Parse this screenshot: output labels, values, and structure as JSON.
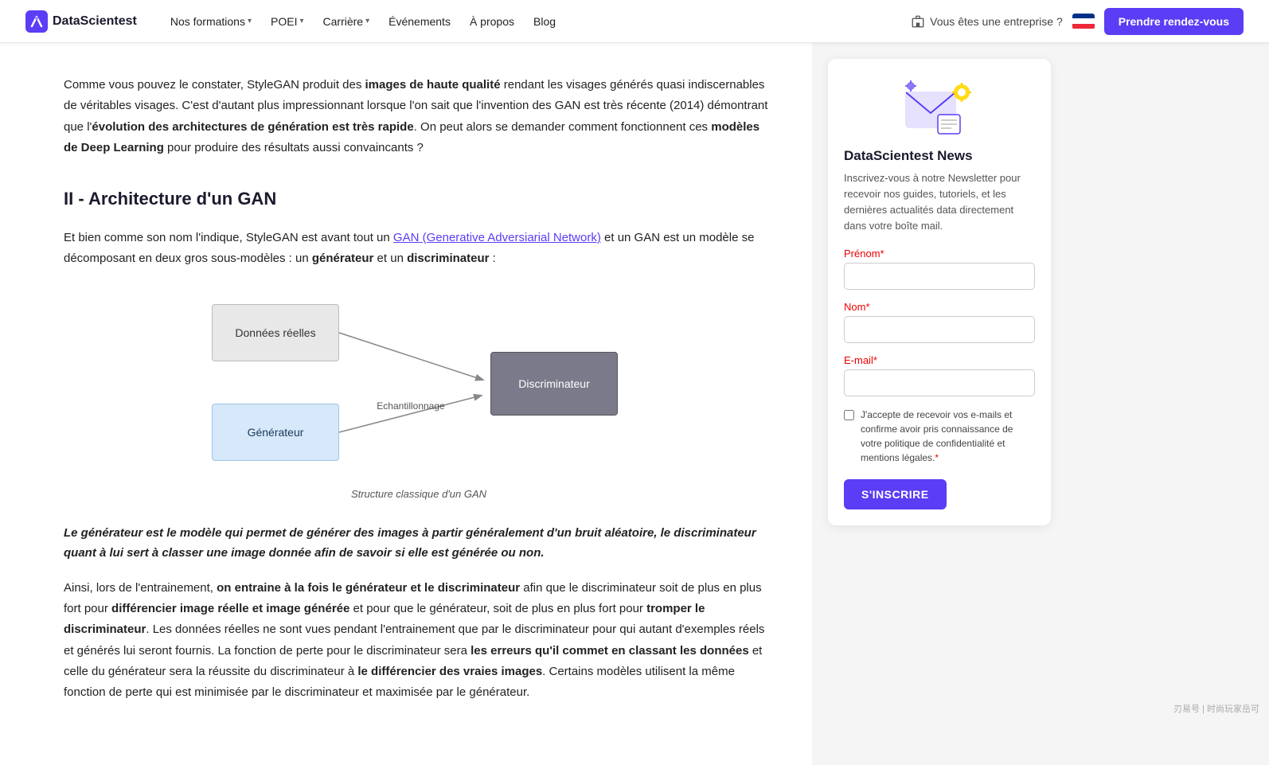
{
  "nav": {
    "logo_text": "DataScientest",
    "links": [
      {
        "label": "Nos formations",
        "has_dropdown": true
      },
      {
        "label": "POEI",
        "has_dropdown": true
      },
      {
        "label": "Carrière",
        "has_dropdown": true
      },
      {
        "label": "Événements",
        "has_dropdown": false
      },
      {
        "label": "À propos",
        "has_dropdown": false
      },
      {
        "label": "Blog",
        "has_dropdown": false
      }
    ],
    "enterprise_label": "Vous êtes une entreprise ?",
    "cta_label": "Prendre rendez-vous"
  },
  "article": {
    "paragraph1": "Comme vous pouvez le constater, StyleGAN produit des ",
    "paragraph1_bold1": "images de haute qualité",
    "paragraph1_rest": " rendant les visages générés quasi indiscernables de véritables visages. C'est d'autant plus impressionnant lorsque l'on sait que l'invention des GAN est très récente (2014) démontrant que l'",
    "paragraph1_bold2": "évolution des architectures de génération est très rapide",
    "paragraph1_end": ". On peut alors se demander comment fonctionnent ces ",
    "paragraph1_bold3": "modèles de Deep Learning",
    "paragraph1_fin": " pour produire des résultats aussi convaincants ?",
    "section_title": "II - Architecture d'un GAN",
    "paragraph2_start": "Et bien comme son nom l'indique, StyleGAN est avant tout un ",
    "paragraph2_link": "GAN (Generative Adversiarial Network)",
    "paragraph2_rest": " et un GAN est un modèle se décomposant en deux gros sous-modèles : un ",
    "paragraph2_bold1": "générateur",
    "paragraph2_and": " et un ",
    "paragraph2_bold2": "discriminateur",
    "paragraph2_end": " :",
    "diagram": {
      "box_data": "Données réelles",
      "box_generator": "Générateur",
      "box_discriminator": "Discriminateur",
      "arrow_label": "Echantillonnage",
      "caption": "Structure classique d'un GAN"
    },
    "blockquote": "Le générateur est le modèle qui permet de générer des images à partir généralement d'un bruit aléatoire, le discriminateur quant à lui sert à classer une image donnée afin de savoir si elle est générée ou non.",
    "paragraph3_start": "Ainsi, lors de l'entrainement, ",
    "paragraph3_bold1": "on entraine à la fois le générateur et le discriminateur",
    "paragraph3_rest1": " afin que le discriminateur soit de plus en plus fort pour ",
    "paragraph3_bold2": "différencier image réelle et image générée",
    "paragraph3_rest2": " et pour que le générateur, soit de plus en plus fort pour ",
    "paragraph3_bold3": "tromper le discriminateur",
    "paragraph3_rest3": ". Les données réelles ne sont vues pendant l'entrainement que par le discriminateur pour qui autant d'exemples réels et générés lui seront fournis. La fonction de perte pour le discriminateur sera ",
    "paragraph3_bold4": "les erreurs qu'il commet en classant les données",
    "paragraph3_rest4": " et celle du générateur sera la réussite du discriminateur à ",
    "paragraph3_bold5": "le différencier des vraies images",
    "paragraph3_end": ". Certains modèles utilisent la même fonction de perte qui est minimisée par le discriminateur et maximisée par le générateur."
  },
  "sidebar": {
    "title": "DataScientest News",
    "description": "Inscrivez-vous à notre Newsletter pour recevoir nos guides, tutoriels, et les dernières actualités data directement dans votre boîte mail.",
    "prenom_label": "Prénom",
    "nom_label": "Nom",
    "email_label": "E-mail",
    "checkbox_text": "J'accepte de recevoir vos e-mails et confirme avoir pris connaissance de votre politique de confidentialité et mentions légales.",
    "subscribe_label": "S'INSCRIRE"
  },
  "watermark": "刃易号 | 时尚玩家岳可"
}
